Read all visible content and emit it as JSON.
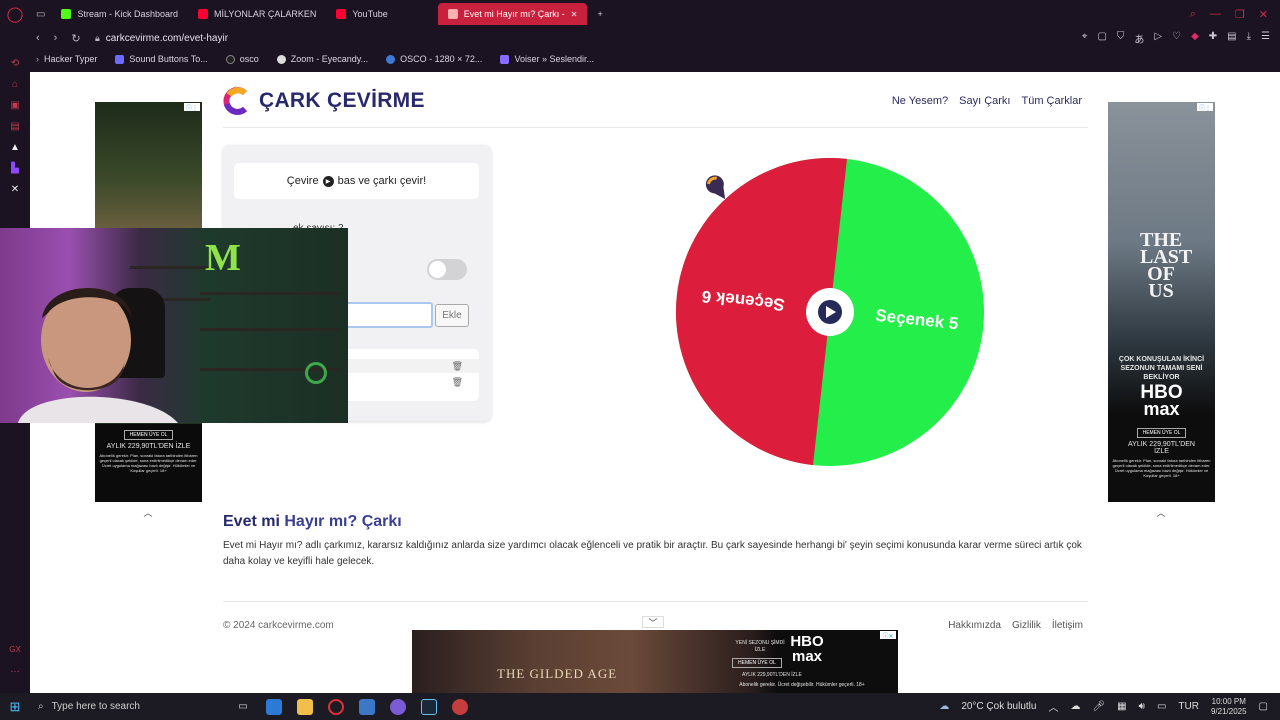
{
  "browser": {
    "tabs": [
      {
        "label": "Stream - Kick Dashboard",
        "color": "#53fc18"
      },
      {
        "label": "MİLYONLAR ÇALARKEN",
        "color": "#ff0033"
      },
      {
        "label": "YouTube",
        "color": "#ff0033"
      },
      {
        "label": "Evet mi Hayır mı? Çarkı -",
        "color": "#ff5a5a"
      }
    ],
    "new_tab": "+",
    "url": "carkcevirme.com/evet-hayir",
    "bookmarks": [
      {
        "label": "Hacker Typer",
        "icon": "arrow-icon"
      },
      {
        "label": "Sound Buttons To...",
        "icon": "bars-icon"
      },
      {
        "label": "osco",
        "icon": "dot-icon"
      },
      {
        "label": "Zoom - Eyecandy...",
        "icon": "globe-icon"
      },
      {
        "label": "OSCO - 1280 × 72...",
        "icon": "globe-icon"
      },
      {
        "label": "Voiser » Seslendir...",
        "icon": "bars-icon"
      }
    ]
  },
  "site": {
    "logo_text": "ÇARK ÇEVİRME",
    "nav": [
      "Ne Yesem?",
      "Sayı Çarkı",
      "Tüm Çarklar"
    ],
    "hint_before": "Çevire",
    "hint_after": "bas ve çarkı çevir!",
    "count_label": "ek sayısı: 2",
    "input_placeholder": "in",
    "add_button": "Ekle",
    "wheel": {
      "segments": [
        {
          "label": "Seçenek 6",
          "color": "#dc1e3c"
        },
        {
          "label": "Seçenek 5",
          "color": "#23ee4a"
        }
      ]
    },
    "heading_part1": "Evet mi ",
    "heading_part2": "Hayır mı? Çarkı",
    "description": "Evet mi Hayır mı? adlı çarkımız, kararsız kaldığınız anlarda size yardımcı olacak eğlenceli ve pratik bir araçtır. Bu çark sayesinde herhangi bi' şeyin seçimi konusunda karar verme süreci artık çok daha kolay ve keyifli hale gelecek.",
    "copyright": "© 2024 carkcevirme.com",
    "footer_links": [
      "Hakkımızda",
      "Gizlilik",
      "İletişim"
    ]
  },
  "ads": {
    "left_cta": "HEMEN ÜYE OL",
    "left_price": "AYLIK 229,90TL'DEN İZLE",
    "left_fine": "Abonelik gerekir. Plan, sonraki fatura tarihinden itibaren geçerli olacak şekilde, sona erdirilmedikçe devam eder. Ücret uygulama mağazası bazlı değişir. Hükümler ve Koşullar geçerli. 18+",
    "right_title": "THE LAST OF US",
    "right_tag": "ÇOK KONUŞULAN İKİNCİ SEZONUN TAMAMI SENİ BEKLİYOR",
    "right_brand1": "HBO",
    "right_brand2": "max",
    "right_cta": "HEMEN ÜYE OL",
    "right_price": "AYLIK 229,90TL'DEN İZLE",
    "right_fine": "Abonelik gerekir. Plan, sonraki fatura tarihinden itibaren geçerli olacak şekilde, sona erdirilmedikçe devam eder. Ücret uygulama mağazası bazlı değişir. Hükümler ve Koşullar geçerli. 18+",
    "bottom_title": "THE GILDED AGE",
    "bottom_tag": "YENİ SEZONU ŞİMDİ İZLE",
    "bottom_cta": "HEMEN ÜYE OL",
    "bottom_price": "AYLIK 229,90TL'DEN İZLE",
    "bottom_fine": "Abonelik gerekir. Ücret değişebilir. Hükümler geçerli. 18+"
  },
  "taskbar": {
    "search_placeholder": "Type here to search",
    "weather": "20°C  Çok bulutlu",
    "lang": "TUR",
    "time": "10:00 PM",
    "date": "9/21/2025"
  }
}
